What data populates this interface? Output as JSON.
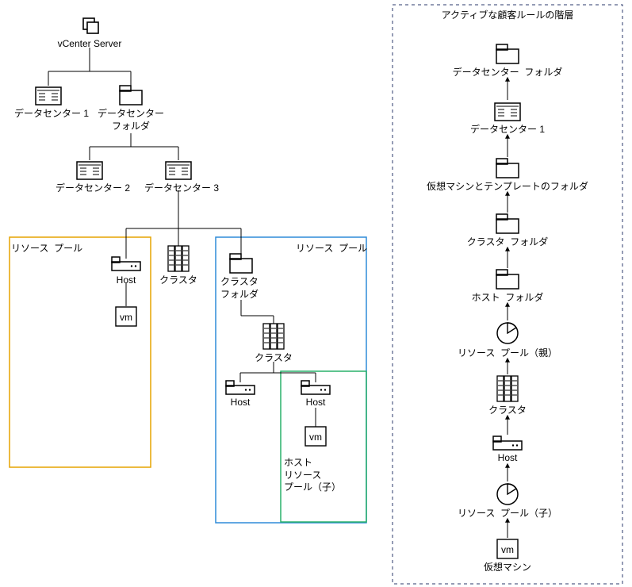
{
  "left_tree": {
    "root_label": "vCenter Server",
    "dc1_label": "データセンター 1",
    "dc_folder_label": "データセンター\nフォルダ",
    "dc2_label": "データセンター 2",
    "dc3_label": "データセンター 3",
    "resource_pool_left": "リソース  プール",
    "resource_pool_right": "リソース  プール",
    "host_left": "Host",
    "vm_left": "vm",
    "cluster1_label": "クラスタ",
    "cluster_folder_label": "クラスタ\nフォルダ",
    "cluster2_label": "クラスタ",
    "host_a": "Host",
    "host_b": "Host",
    "vm_b": "vm",
    "host_rp_child_label": "ホスト\nリソース\nプール（子）"
  },
  "right_chain": {
    "title": "アクティブな顧客ルールの階層",
    "n0": "データセンター  フォルダ",
    "n1": "データセンター 1",
    "n2": "仮想マシンとテンプレートのフォルダ",
    "n3": "クラスタ  フォルダ",
    "n4": "ホスト  フォルダ",
    "n5": "リソース  プール（親）",
    "n6": "クラスタ",
    "n7": "Host",
    "n8": "リソース  プール（子）",
    "n9": "仮想マシン",
    "vm_box": "vm"
  }
}
